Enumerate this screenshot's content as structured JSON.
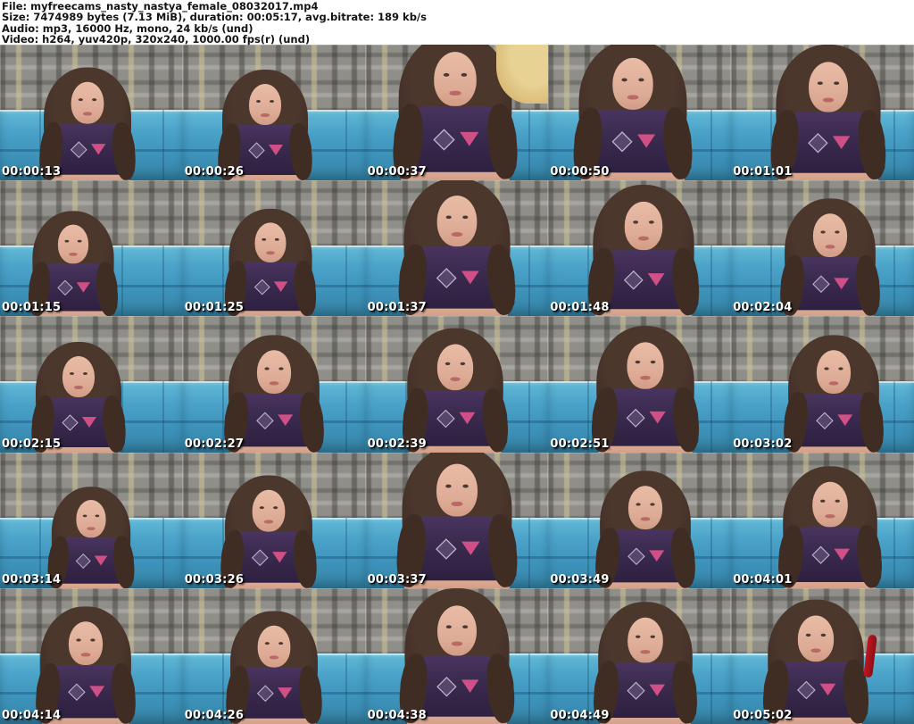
{
  "header": {
    "lines": [
      "File: myfreecams_nasty_nastya_female_08032017.mp4",
      "Size: 7474989 bytes (7.13 MiB), duration: 00:05:17, avg.bitrate: 189 kb/s",
      "Audio: mp3, 16000 Hz, mono, 24 kb/s (und)",
      "Video: h264, yuv420p, 320x240, 1000.00 fps(r) (und)"
    ]
  },
  "grid": {
    "columns": 5,
    "rows": 5,
    "thumbnails": [
      {
        "timestamp": "00:00:13"
      },
      {
        "timestamp": "00:00:26"
      },
      {
        "timestamp": "00:00:37"
      },
      {
        "timestamp": "00:00:50"
      },
      {
        "timestamp": "00:01:01"
      },
      {
        "timestamp": "00:01:15"
      },
      {
        "timestamp": "00:01:25"
      },
      {
        "timestamp": "00:01:37"
      },
      {
        "timestamp": "00:01:48"
      },
      {
        "timestamp": "00:02:04"
      },
      {
        "timestamp": "00:02:15"
      },
      {
        "timestamp": "00:02:27"
      },
      {
        "timestamp": "00:02:39"
      },
      {
        "timestamp": "00:02:51"
      },
      {
        "timestamp": "00:03:02"
      },
      {
        "timestamp": "00:03:14"
      },
      {
        "timestamp": "00:03:26"
      },
      {
        "timestamp": "00:03:37"
      },
      {
        "timestamp": "00:03:49"
      },
      {
        "timestamp": "00:04:01"
      },
      {
        "timestamp": "00:04:14"
      },
      {
        "timestamp": "00:04:26"
      },
      {
        "timestamp": "00:04:38"
      },
      {
        "timestamp": "00:04:49"
      },
      {
        "timestamp": "00:05:02"
      }
    ]
  },
  "colors": {
    "background": "#ffffff",
    "header_text": "#141414",
    "timestamp_text": "#ffffff",
    "timestamp_shadow": "#000000",
    "couch_blue": "#4aa2c8",
    "wallpaper_gray": "#8f8e88",
    "shirt_purple": "#3a2a4e",
    "hair_brown": "#43302a",
    "skin_tone": "#ddab95"
  }
}
